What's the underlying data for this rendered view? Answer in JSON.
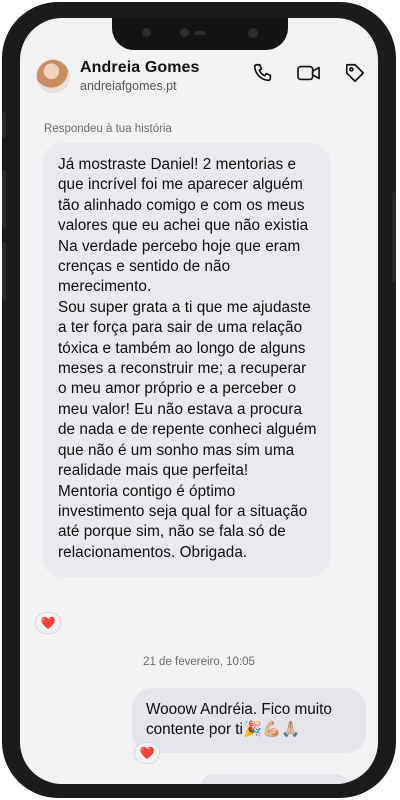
{
  "contact": {
    "name": "Andreia Gomes",
    "handle": "andreiafgomes.pt"
  },
  "header_icons": [
    "phone-icon",
    "video-icon",
    "tag-icon"
  ],
  "story_reply_label": "Respondeu à tua história",
  "incoming_message": {
    "paragraphs": [
      "Já mostraste Daniel! 2 mentorias e que incrível foi me aparecer alguém tão alinhado comigo e com os meus valores que eu achei que não existia",
      "Na verdade percebo hoje que eram crenças e sentido de não merecimento.",
      "Sou super grata a ti que me ajudaste a ter força para sair de uma relação tóxica e também ao longo de alguns meses a reconstruir me; a recuperar o meu amor próprio e a perceber o meu valor! Eu não estava a procura de nada e de repente conheci alguém que não é um sonho mas sim uma realidade mais que perfeita!",
      "Mentoria contigo é óptimo investimento seja qual for a situação até porque sim, não se fala só de relacionamentos. Obrigada."
    ],
    "reaction": "❤️"
  },
  "date_separator": "21 de fevereiro, 10:05",
  "outgoing_message": {
    "text": "Wooow Andréia. Fico muito contente por ti🎉💪🏼🙏🏼",
    "reaction": "❤️"
  },
  "colors": {
    "screen_bg": "#f2f2f4",
    "bubble_bg": "#e9e9ee",
    "phone_frame": "#1b1b1b"
  }
}
